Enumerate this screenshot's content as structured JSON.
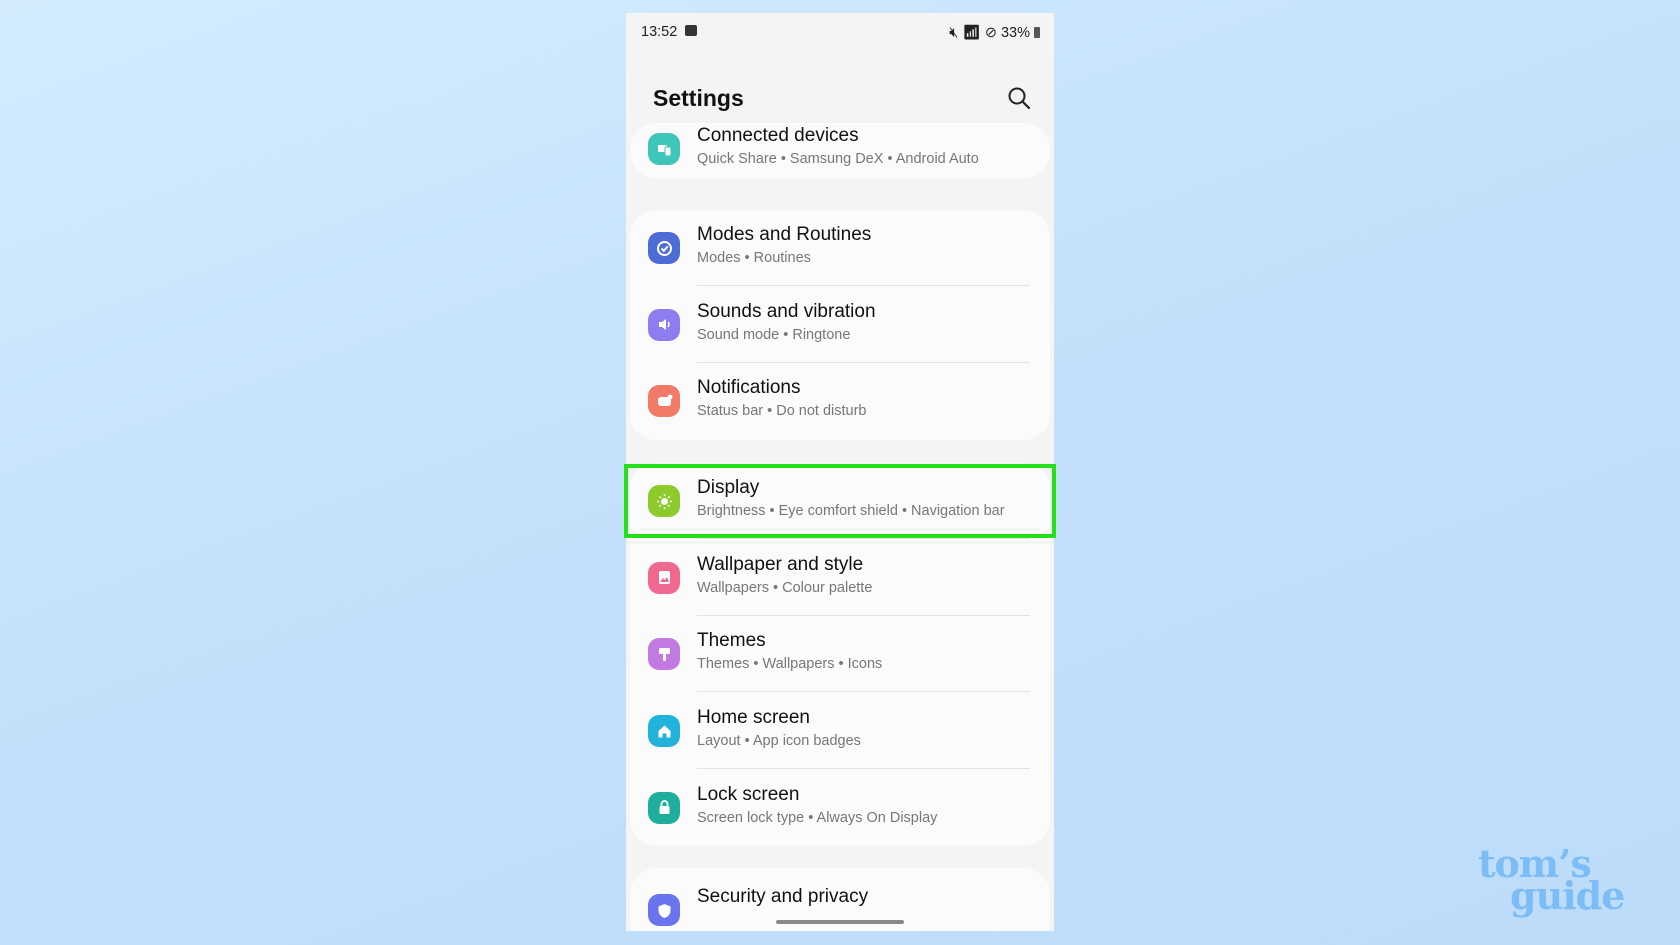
{
  "status_bar": {
    "time": "13:52",
    "battery": "33%",
    "icons": [
      "gallery-icon",
      "mute-icon",
      "wifi-icon",
      "do-not-disturb-icon",
      "battery-icon"
    ]
  },
  "header": {
    "title": "Settings",
    "search_icon": "search-icon"
  },
  "groups": [
    {
      "items": [
        {
          "title": "Connected devices",
          "subtitle": "Quick Share  •  Samsung DeX  •  Android Auto",
          "icon": "connected-devices-icon",
          "color": "#3ec6ba"
        }
      ]
    },
    {
      "items": [
        {
          "title": "Modes and Routines",
          "subtitle": "Modes  •  Routines",
          "icon": "modes-icon",
          "color": "#4d6cd8"
        },
        {
          "title": "Sounds and vibration",
          "subtitle": "Sound mode  •  Ringtone",
          "icon": "speaker-icon",
          "color": "#8c7df1"
        },
        {
          "title": "Notifications",
          "subtitle": "Status bar  •  Do not disturb",
          "icon": "notification-icon",
          "color": "#f27a68"
        }
      ]
    },
    {
      "items": [
        {
          "title": "Display",
          "subtitle": "Brightness  •  Eye comfort shield  •  Navigation bar",
          "icon": "sun-icon",
          "color": "#8ccb2b"
        },
        {
          "title": "Wallpaper and style",
          "subtitle": "Wallpapers  •  Colour palette",
          "icon": "image-icon",
          "color": "#ee6890"
        },
        {
          "title": "Themes",
          "subtitle": "Themes  •  Wallpapers  •  Icons",
          "icon": "brush-icon",
          "color": "#c27ae2"
        },
        {
          "title": "Home screen",
          "subtitle": "Layout  •  App icon badges",
          "icon": "home-icon",
          "color": "#22b3dc"
        },
        {
          "title": "Lock screen",
          "subtitle": "Screen lock type  •  Always On Display",
          "icon": "lock-icon",
          "color": "#1fae9b"
        }
      ]
    },
    {
      "items": [
        {
          "title": "Security and privacy",
          "subtitle": "",
          "icon": "shield-icon",
          "color": "#6a74ef"
        }
      ]
    }
  ],
  "highlight": {
    "target": "Display",
    "color": "#23e01a"
  },
  "watermark": {
    "text": [
      "tom's",
      "guide"
    ]
  }
}
